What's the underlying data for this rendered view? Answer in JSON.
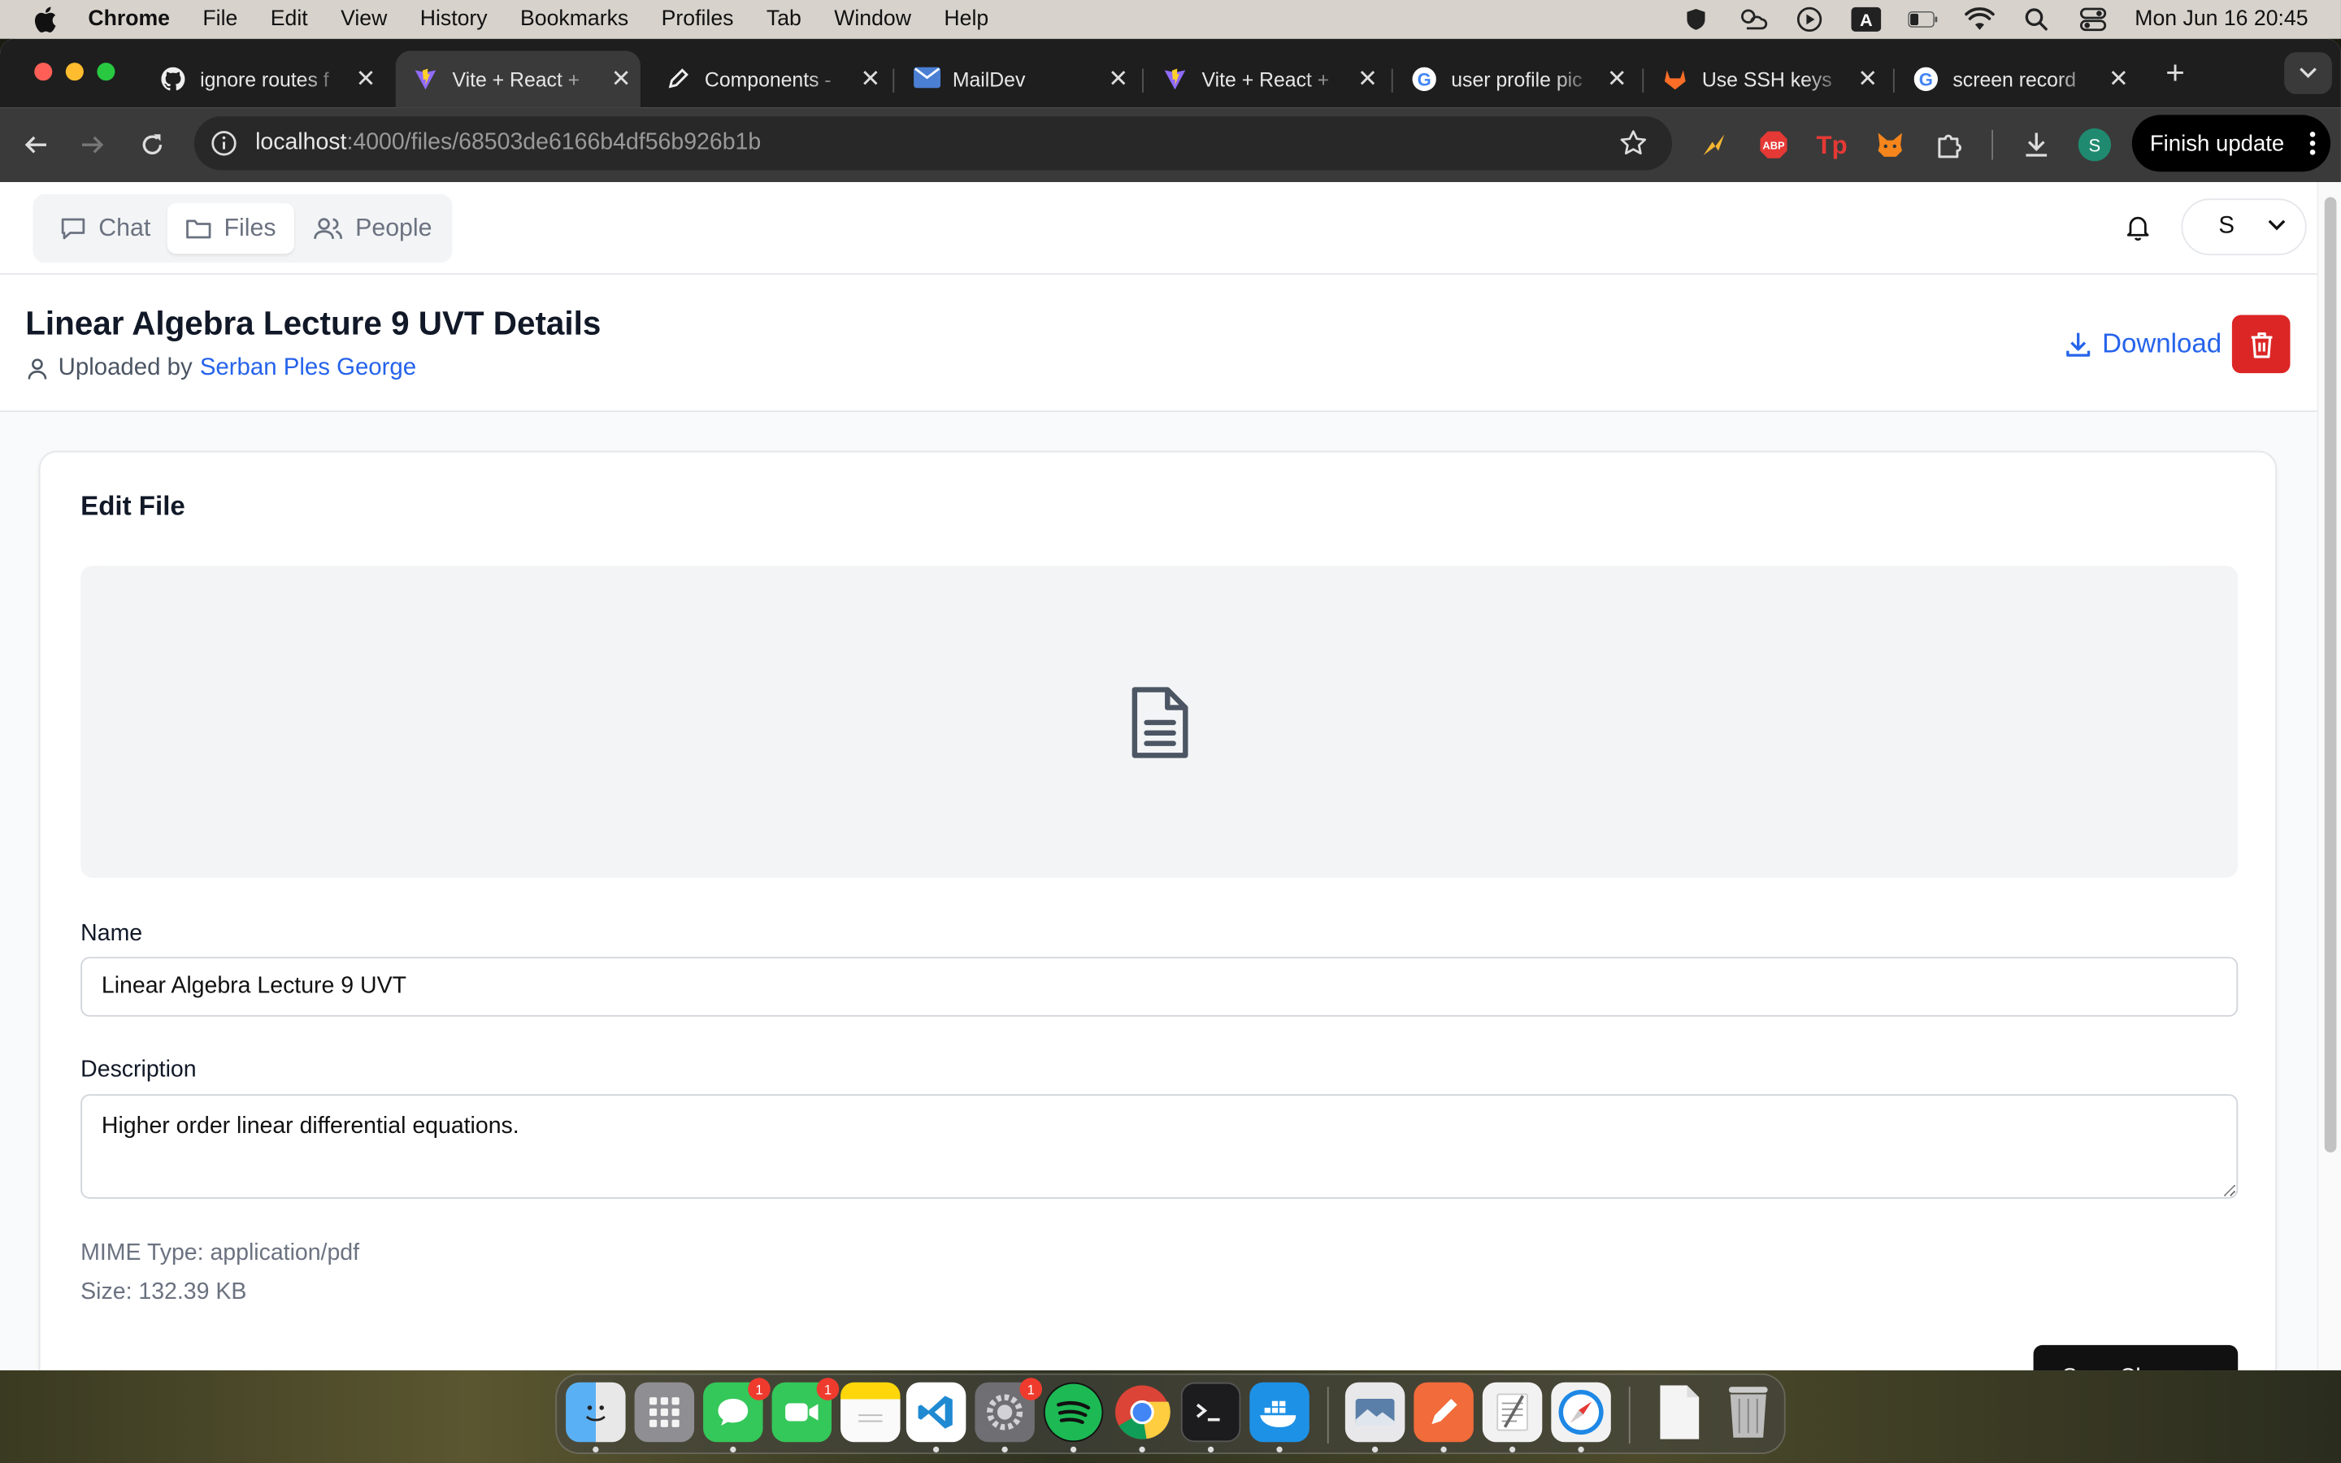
{
  "menubar": {
    "app": "Chrome",
    "items": [
      "File",
      "Edit",
      "View",
      "History",
      "Bookmarks",
      "Profiles",
      "Tab",
      "Window",
      "Help"
    ],
    "clock": "Mon Jun 16  20:45"
  },
  "tabs": [
    {
      "title": "ignore routes f",
      "icon": "github-icon"
    },
    {
      "title": "Vite + React +",
      "icon": "vite-icon",
      "active": true
    },
    {
      "title": "Components -",
      "icon": "pen-icon"
    },
    {
      "title": "MailDev",
      "icon": "mail-icon"
    },
    {
      "title": "Vite + React +",
      "icon": "vite-icon"
    },
    {
      "title": "user profile pic",
      "icon": "google-icon"
    },
    {
      "title": "Use SSH keys",
      "icon": "gitlab-icon"
    },
    {
      "title": "screen record",
      "icon": "google-icon"
    }
  ],
  "address": {
    "host": "localhost",
    "path": ":4000/files/68503de6166b4df56b926b1b"
  },
  "toolbar": {
    "finish_update": "Finish update",
    "profile_initial": "S"
  },
  "nav": {
    "chat": "Chat",
    "files": "Files",
    "people": "People",
    "user_initial": "S"
  },
  "file": {
    "title": "Linear Algebra Lecture 9 UVT Details",
    "uploaded_by_label": "Uploaded by",
    "uploader": "Serban Ples George",
    "download_label": "Download"
  },
  "form": {
    "heading": "Edit File",
    "name_label": "Name",
    "name_value": "Linear Algebra Lecture 9 UVT",
    "description_label": "Description",
    "description_value": "Higher order linear differential equations.",
    "mime": "MIME Type: application/pdf",
    "size": "Size: 132.39 KB",
    "save_label": "Save Changes"
  },
  "dock": {
    "apps": [
      "finder",
      "launchpad",
      "messages",
      "facetime",
      "notes",
      "vscode",
      "system-settings",
      "spotify",
      "chrome",
      "terminal",
      "docker",
      "preview",
      "pencil-app",
      "textedit",
      "safari",
      "document",
      "trash"
    ],
    "messages_badge": "1",
    "facetime_badge": "1",
    "settings_badge": "1"
  },
  "colors": {
    "accent_blue": "#2563eb",
    "danger_red": "#dc2626",
    "tab_bar": "#1e1e1e"
  }
}
